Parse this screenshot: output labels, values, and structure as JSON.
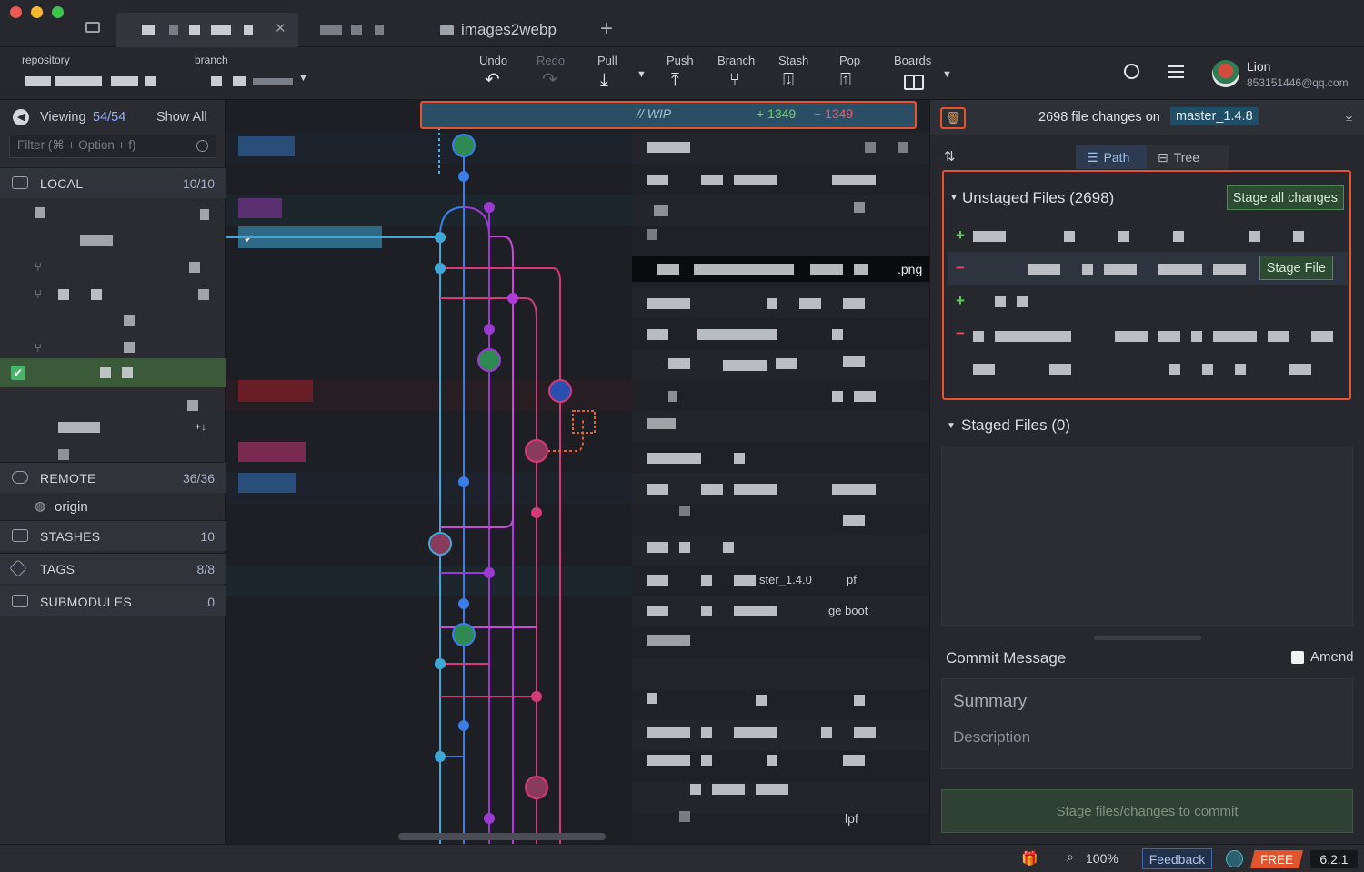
{
  "tabs": {
    "repo_tab": "images2webp",
    "add_tab": "+"
  },
  "toolbar": {
    "repository_label": "repository",
    "branch_label": "branch",
    "undo": "Undo",
    "redo": "Redo",
    "pull": "Pull",
    "push": "Push",
    "branch": "Branch",
    "stash": "Stash",
    "pop": "Pop",
    "boards": "Boards"
  },
  "user": {
    "name": "Lion",
    "email": "853151446@qq.com"
  },
  "left_panel": {
    "viewing_prefix": "Viewing",
    "viewing_count": "54/54",
    "show_all": "Show All",
    "filter_placeholder": "Filter (⌘ + Option + f)",
    "sections": {
      "local": {
        "label": "LOCAL",
        "count": "10/10"
      },
      "remote": {
        "label": "REMOTE",
        "count": "36/36",
        "origin": "origin"
      },
      "stashes": {
        "label": "STASHES",
        "count": "10"
      },
      "tags": {
        "label": "TAGS",
        "count": "8/8"
      },
      "submodules": {
        "label": "SUBMODULES",
        "count": "0"
      }
    }
  },
  "wip": {
    "label": "// WIP",
    "added": "+ 1349",
    "removed": "− 1349"
  },
  "graph_messages": {
    "png_item": ".png",
    "row_a": "ster_1.4.0",
    "row_b": "pf",
    "row_c": "ge boot",
    "row_d": "lpf"
  },
  "right_panel": {
    "file_changes": "2698 file changes on",
    "branch": "master_1.4.8",
    "view_path": "Path",
    "view_tree": "Tree",
    "unstaged_title": "Unstaged Files (2698)",
    "stage_all": "Stage all changes",
    "stage_file": "Stage File",
    "staged_title": "Staged Files (0)",
    "commit_message": "Commit Message",
    "amend": "Amend",
    "summary_placeholder": "Summary",
    "description_placeholder": "Description",
    "commit_button": "Stage files/changes to commit"
  },
  "status_bar": {
    "zoom": "100%",
    "feedback": "Feedback",
    "free": "FREE",
    "version": "6.2.1"
  },
  "colors": {
    "accent_orange": "#e5542c",
    "green": "#4d8a56",
    "blue_lane": "#3b8ee0",
    "purple_lane": "#9b3ad1",
    "pink_lane": "#d23a7a",
    "cyan_lane": "#3fa8d6"
  }
}
